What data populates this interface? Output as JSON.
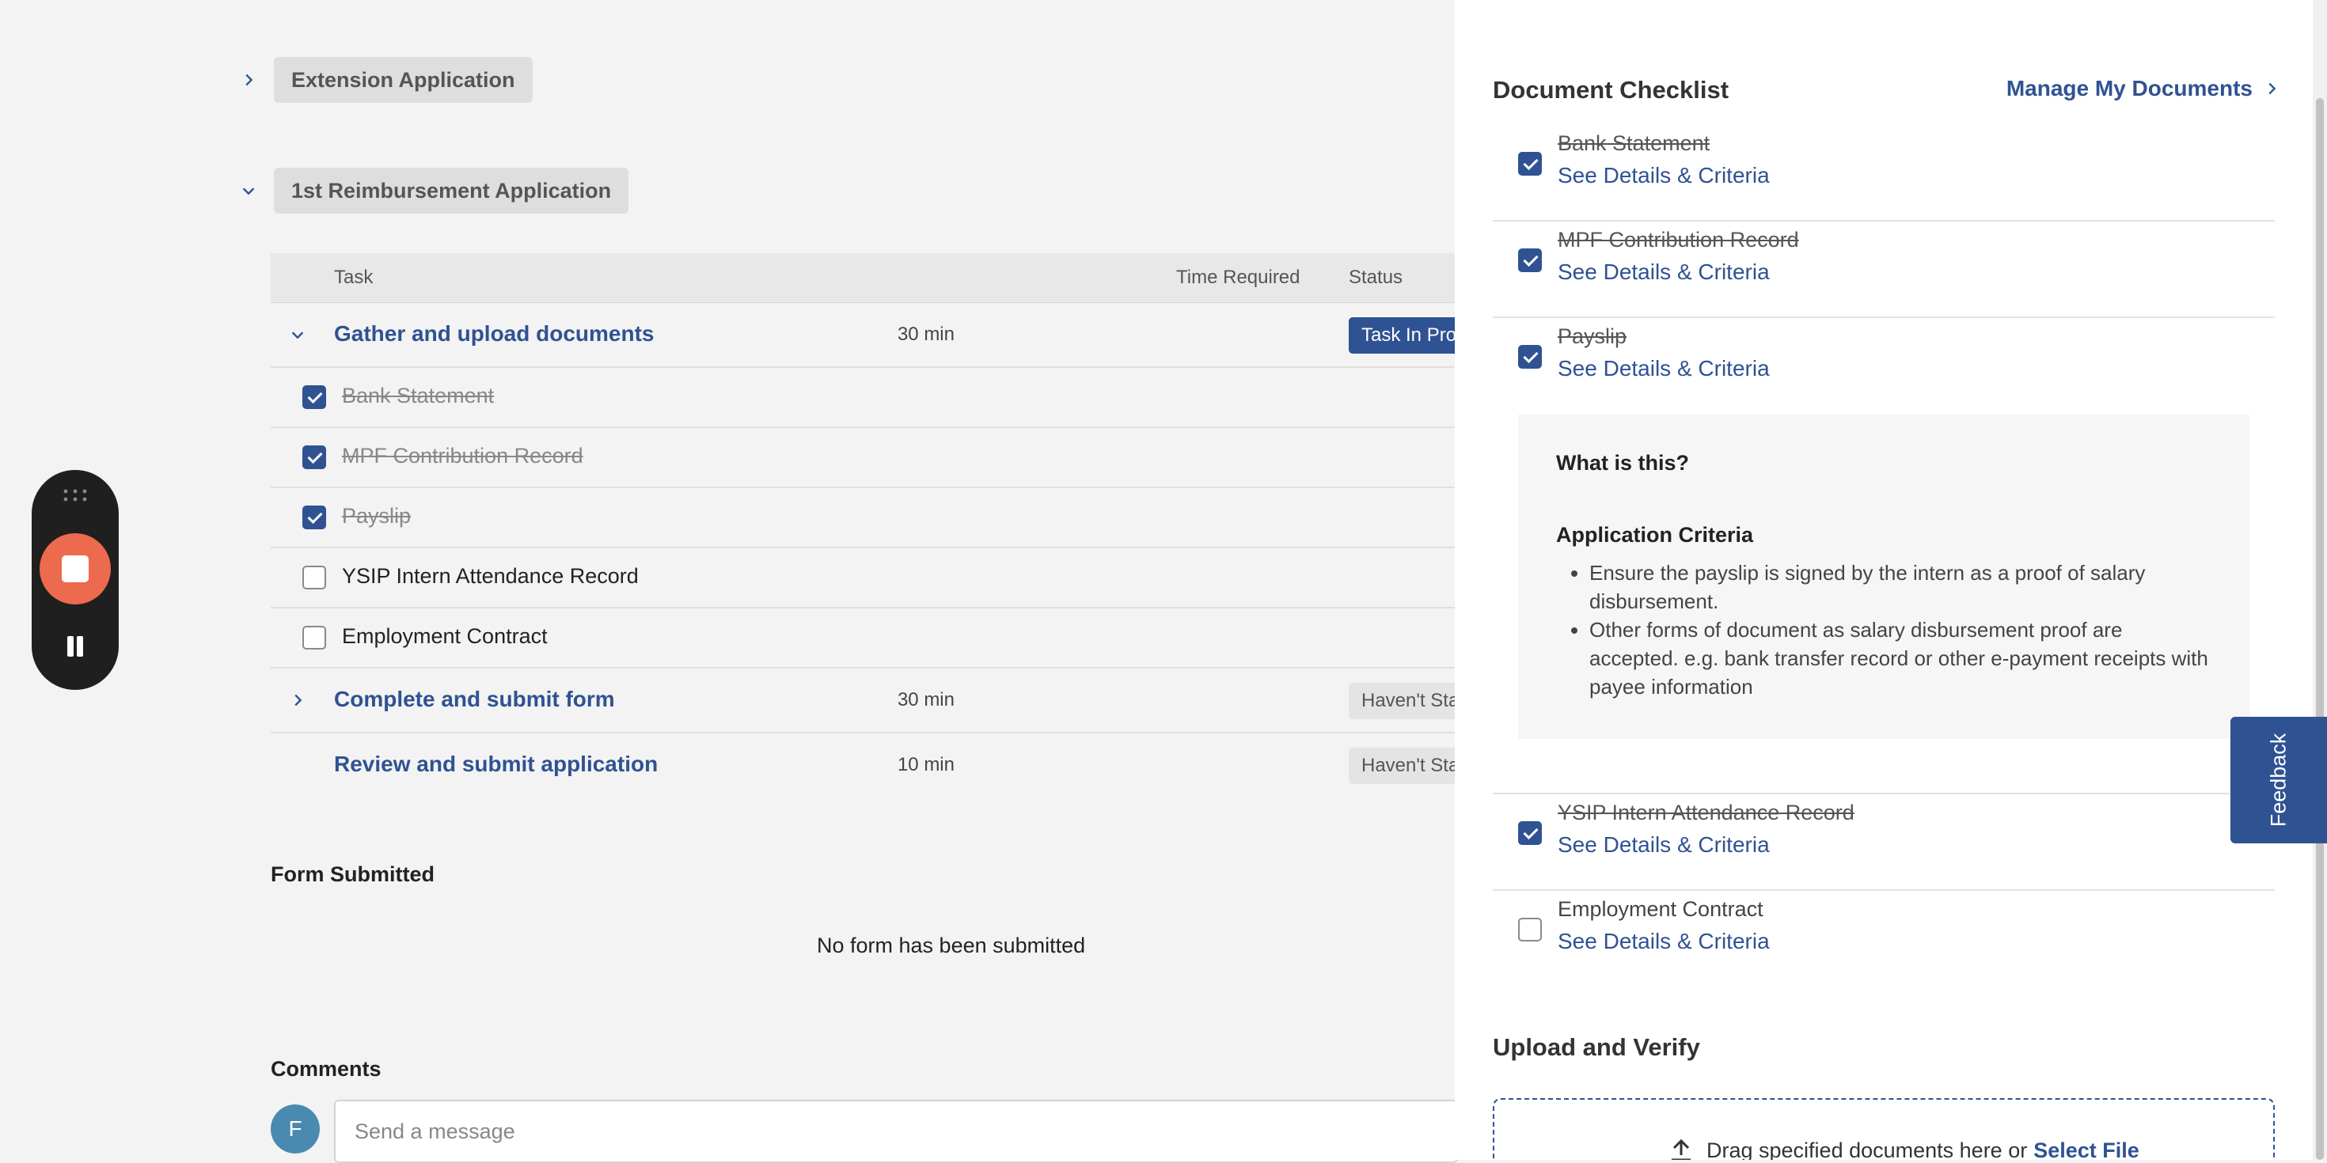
{
  "sections": {
    "extension": {
      "label": "Extension Application"
    },
    "reimbursement": {
      "label": "1st Reimbursement Application"
    }
  },
  "table": {
    "headers": {
      "task": "Task",
      "time": "Time Required",
      "status": "Status"
    },
    "tasks": [
      {
        "title": "Gather and upload documents",
        "time": "30 min",
        "status": "Task In Progress"
      },
      {
        "title": "Complete and submit form",
        "time": "30 min",
        "status": "Haven't Started"
      },
      {
        "title": "Review and submit application",
        "time": "10 min",
        "status": "Haven't Started"
      }
    ],
    "documents": [
      {
        "label": "Bank Statement",
        "checked": true
      },
      {
        "label": "MPF Contribution Record",
        "checked": true
      },
      {
        "label": "Payslip",
        "checked": true
      },
      {
        "label": "YSIP Intern Attendance Record",
        "checked": false
      },
      {
        "label": "Employment Contract",
        "checked": false
      }
    ]
  },
  "form": {
    "heading": "Form Submitted",
    "empty_text": "No form has been submitted"
  },
  "comments": {
    "heading": "Comments",
    "avatar_initial": "F",
    "placeholder": "Send a message"
  },
  "drawer": {
    "title": "Document Checklist",
    "manage_link": "Manage My Documents",
    "details_link": "See Details & Criteria",
    "items": [
      {
        "label": "Bank Statement",
        "checked": true
      },
      {
        "label": "MPF Contribution Record",
        "checked": true
      },
      {
        "label": "Payslip",
        "checked": true
      },
      {
        "label": "YSIP Intern Attendance Record",
        "checked": true
      },
      {
        "label": "Employment Contract",
        "checked": false
      }
    ],
    "info": {
      "question": "What is this?",
      "criteria_heading": "Application Criteria",
      "criteria": [
        "Ensure the payslip is signed by the intern as a proof of salary disbursement.",
        "Other forms of document as salary disbursement proof are accepted. e.g. bank transfer record or other e-payment receipts with payee information"
      ]
    },
    "upload": {
      "heading": "Upload and Verify",
      "drop_text": "Drag specified documents here or",
      "select_link": "Select File"
    }
  },
  "feedback": {
    "label": "Feedback"
  },
  "colors": {
    "accent": "#2f5292",
    "record": "#ec6a4e"
  }
}
